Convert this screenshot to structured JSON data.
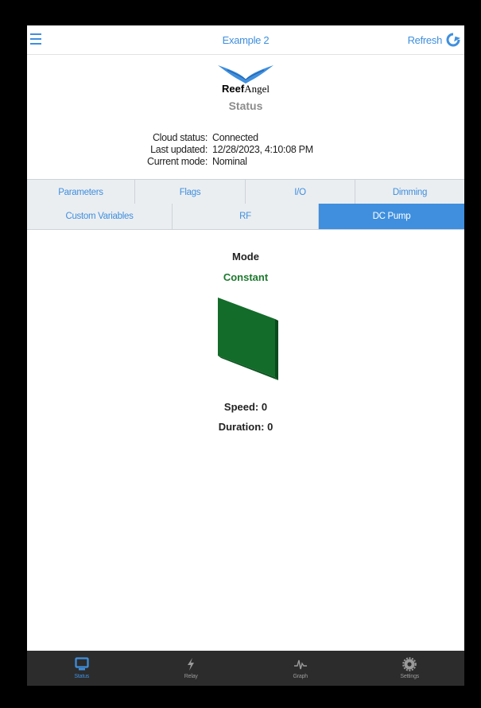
{
  "header": {
    "title": "Example 2",
    "refresh_label": "Refresh",
    "menu_icon": "hamburger-menu-icon",
    "refresh_icon": "refresh-icon"
  },
  "brand": {
    "name_bold": "Reef",
    "name_regular": "Angel",
    "logo_icon": "reef-angel-wings-logo"
  },
  "status_heading": "Status",
  "info": {
    "cloud_status_label": "Cloud status:",
    "cloud_status_value": "Connected",
    "last_updated_label": "Last updated:",
    "last_updated_value": "12/28/2023, 4:10:08 PM",
    "current_mode_label": "Current mode:",
    "current_mode_value": "Nominal"
  },
  "tabs_row1": [
    "Parameters",
    "Flags",
    "I/O",
    "Dimming"
  ],
  "tabs_row2": [
    "Custom Variables",
    "RF",
    "DC Pump"
  ],
  "active_tab": "DC Pump",
  "dc_pump": {
    "mode_label": "Mode",
    "mode_value": "Constant",
    "speed_text": "Speed:  0",
    "duration_text": "Duration:  0"
  },
  "bottom_nav": [
    {
      "label": "Status",
      "icon": "monitor-icon",
      "active": true
    },
    {
      "label": "Relay",
      "icon": "lightning-bolt-icon",
      "active": false
    },
    {
      "label": "Graph",
      "icon": "pulse-graph-icon",
      "active": false
    },
    {
      "label": "Settings",
      "icon": "gear-icon",
      "active": false
    }
  ],
  "colors": {
    "accent": "#3f8fde",
    "mode_green": "#1d7a2e",
    "nav_background": "#2c2c2c",
    "tab_background": "#ebeef1"
  }
}
